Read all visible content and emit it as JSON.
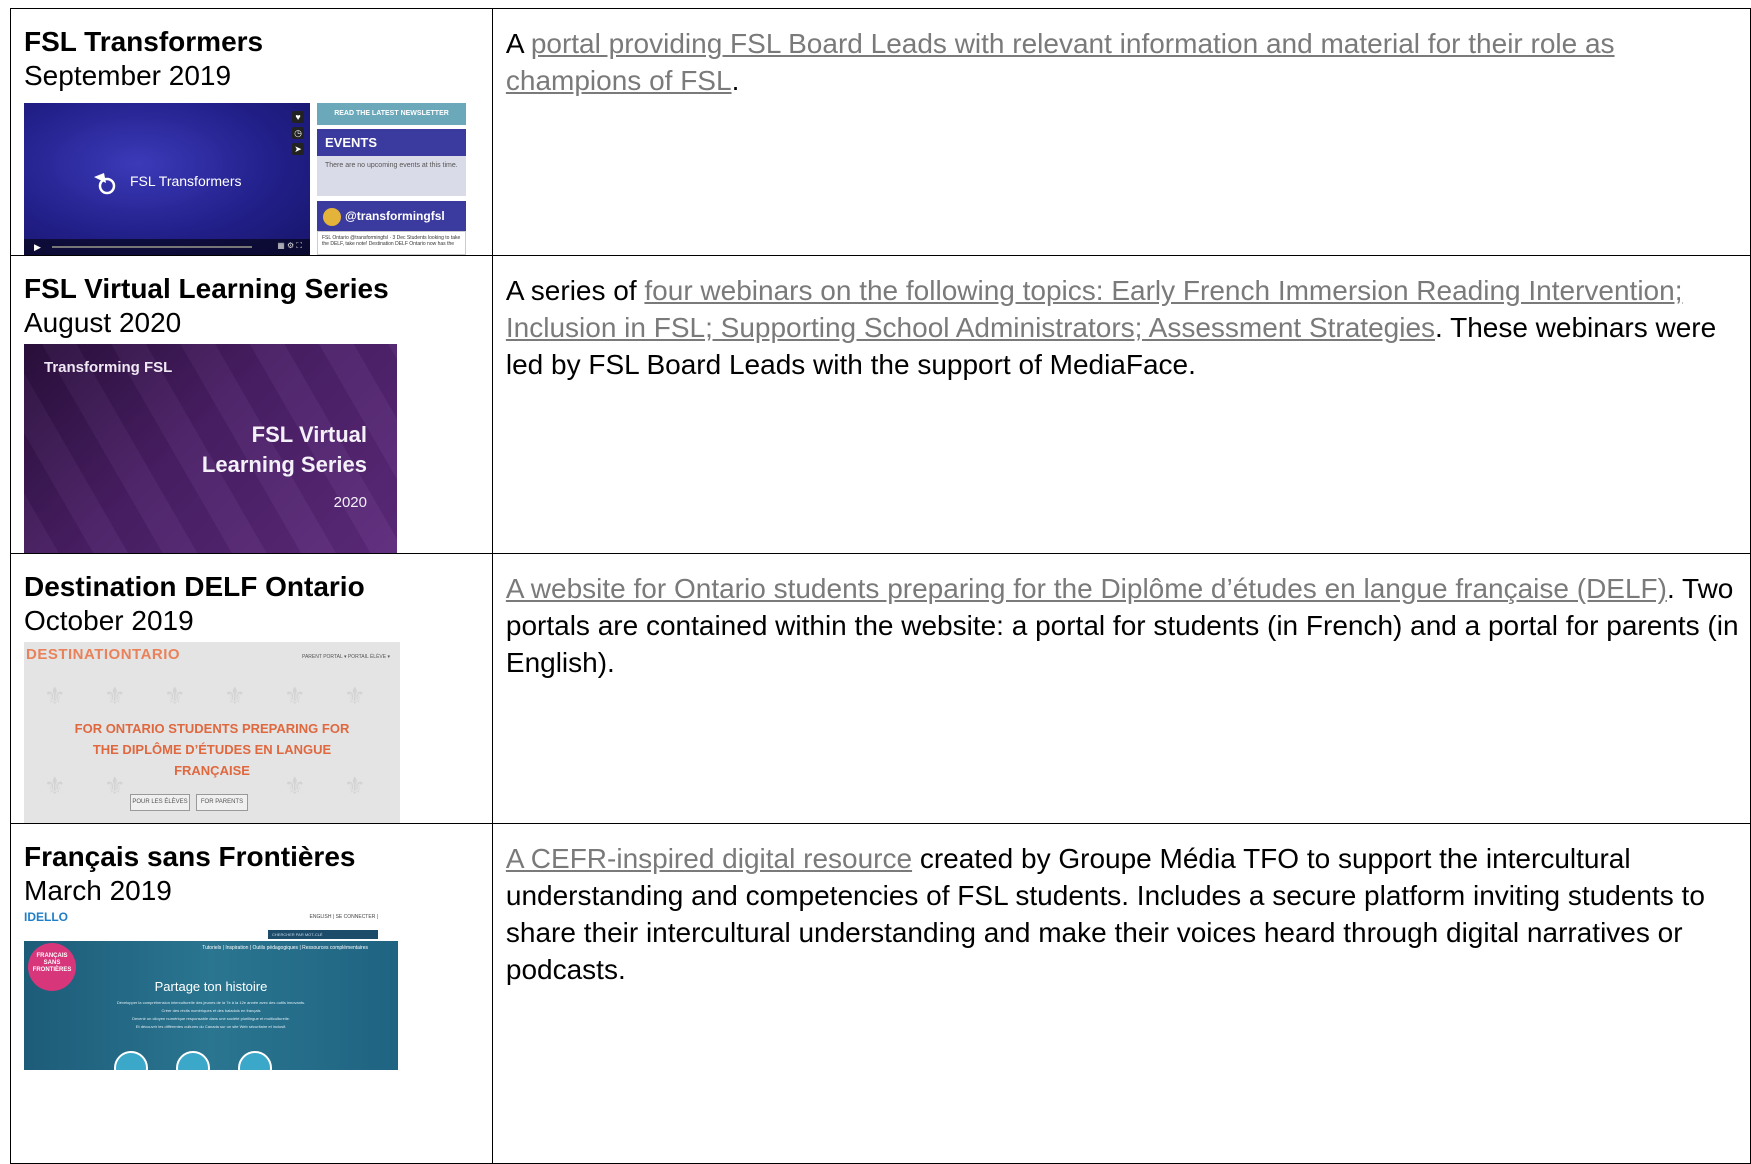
{
  "rows": [
    {
      "name": "FSL Transformers",
      "date": "September 2019",
      "desc_before": "A ",
      "link_text": "portal providing FSL Board Leads with relevant information and material for their role as champions of FSL",
      "desc_after": ".",
      "thumb": {
        "video_title": "FSL Transformers",
        "newsletter": "READ THE LATEST NEWSLETTER",
        "events_title": "EVENTS",
        "events_text": "There are no upcoming events at this time.",
        "handle": "@transformingfsl",
        "tweet_text": "FSL Ontario @transformingfsl · 3 Dec  Students looking to take the DELF, take note! Destination DELF Ontario now has the"
      }
    },
    {
      "name": "FSL Virtual Learning Series",
      "date": "August 2020",
      "desc_before": "A series of ",
      "link_text": "four webinars on the following topics: Early French Immersion Reading Intervention; Inclusion in FSL; Supporting School Administrators; Assessment Strategies",
      "desc_after": ". These webinars were led by FSL Board Leads with the support of MediaFace.",
      "thumb": {
        "top": "Transforming FSL",
        "title_line1": "FSL Virtual",
        "title_line2": "Learning Series",
        "year": "2020"
      }
    },
    {
      "name": "Destination DELF Ontario",
      "date": "October 2019",
      "desc_before": "",
      "link_text": "A website for Ontario students preparing for the Diplôme d’études en langue française (DELF)",
      "desc_after": ". Two portals are contained within the website: a portal for students (in French) and a portal for parents (in English).",
      "thumb": {
        "logo": "DESTINATIONTARIO",
        "nav": "PARENT PORTAL ▾   PORTAIL ÉLÈVE ▾",
        "heading_line1": "FOR ONTARIO STUDENTS PREPARING FOR",
        "heading_line2": "THE DIPLÔME D’ÉTUDES EN LANGUE",
        "heading_line3": "FRANÇAISE",
        "btn_students": "POUR LES ÉLÈVES",
        "btn_parents": "FOR PARENTS"
      }
    },
    {
      "name": "Français sans Frontières",
      "date": "March 2019",
      "desc_before": "",
      "link_text": "A CEFR-inspired digital resource",
      "desc_after": " created by Groupe Média TFO to support the intercultural understanding and competencies of FSL students. Includes a secure platform inviting students to share their intercultural understanding and make their voices heard through digital narratives or podcasts.",
      "thumb": {
        "logo": "IDELLO",
        "topnav": "ENGLISH  |  SE CONNECTER  |",
        "search": "CHERCHER PAR MOT-CLÉ",
        "menu": "Tutoriels  |  Inspiration  |  Outils pédagogiques  |  Ressources complémentaires",
        "badge": "FRANÇAIS SANS FRONTIÈRES",
        "heading": "Partage ton histoire",
        "line1": "Développer la compréhension interculturelle des jeunes de la 7e à la 12e année avec des outils innovants.",
        "line2": "Créer des récits numériques et des baladois en français",
        "line3": "Devenir un citoyen numérique responsable dans une société plurilingue et multiculturelle.",
        "line4": "Et découvrir les différentes cultures du Canada sur un site Web sécuritaire et inclusif."
      }
    }
  ]
}
